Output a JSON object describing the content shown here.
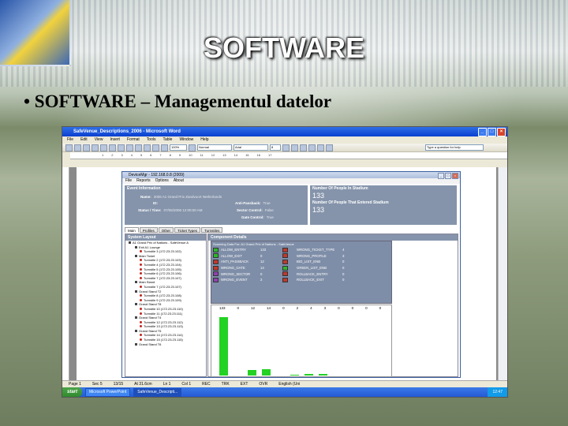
{
  "slide": {
    "title": "SOFTWARE",
    "bullet": "• SOFTWARE – Managementul datelor"
  },
  "word": {
    "window_title": "SafeVenue_Descriptions_2006 - Microsoft Word",
    "menus": [
      "File",
      "Edit",
      "View",
      "Insert",
      "Format",
      "Tools",
      "Table",
      "Window",
      "Help"
    ],
    "zoom": "100%",
    "style": "Normal",
    "font": "Arial",
    "size": "8",
    "help_placeholder": "Type a question for help",
    "ruler_ticks": [
      "1",
      "2",
      "3",
      "4",
      "5",
      "6",
      "7",
      "8",
      "9",
      "10",
      "11",
      "12",
      "13",
      "14",
      "15",
      "16",
      "17"
    ],
    "status": [
      "Page 1",
      "Sec 5",
      "13/15",
      "At 31.6cm",
      "Ln 1",
      "Col 1",
      "REC",
      "TRK",
      "EXT",
      "OVR",
      "English (Uni"
    ]
  },
  "taskbar": {
    "start": "start",
    "tasks": [
      "Microsoft PowerPoint",
      "SafeVenue_Descripti..."
    ],
    "clock": "12:47"
  },
  "app": {
    "title": "DeviceMgr - 192.168.0.8 (2009)",
    "menu": [
      "File",
      "Reports",
      "Options",
      "About"
    ],
    "event_header": "Event Information",
    "event_name_label": "Name:",
    "event_name": "2006 A1 Grand Prix Zandvoort Netherlands",
    "id_label": "ID:",
    "id_value": "",
    "status_label": "Status / Time:",
    "status_value": "07/06/2006 12:00:00 AM",
    "anti_label": "Anti-Passback:",
    "anti_value": "True",
    "sector_label": "Sector Control:",
    "sector_value": "False",
    "gate_label": "Gate Control:",
    "gate_value": "True",
    "np_header": "Number Of People In Stadium",
    "np_value": "133",
    "np2_header": "Number Of People That Entered Stadium",
    "np2_value": "133",
    "tabs": [
      "Main",
      "Profiles",
      "Other",
      "Ticket Types",
      "Turnstiles"
    ],
    "system_layout": "System Layout",
    "tree": [
      {
        "level": 1,
        "kind": "sq",
        "text": "A1 Grand Prix of Nations - SafeVenue A"
      },
      {
        "level": 2,
        "kind": "sq",
        "text": "Exit A1 Lounge"
      },
      {
        "level": 3,
        "kind": "dot",
        "text": "Turnstile 3 (172.23.23.102)"
      },
      {
        "level": 2,
        "kind": "sq",
        "text": "Main Ticket"
      },
      {
        "level": 3,
        "kind": "dot",
        "text": "Turnstile 2 (172.23.23.103)"
      },
      {
        "level": 3,
        "kind": "dot",
        "text": "Turnstile 4 (172.23.23.104)"
      },
      {
        "level": 3,
        "kind": "dot",
        "text": "Turnstile 5 (172.23.23.105)"
      },
      {
        "level": 3,
        "kind": "dot",
        "text": "Turnstile 6 (172.23.23.106)"
      },
      {
        "level": 3,
        "kind": "dot",
        "text": "Turnstile 7 (172.23.23.107)"
      },
      {
        "level": 2,
        "kind": "sq",
        "text": "Main Stand"
      },
      {
        "level": 3,
        "kind": "dot",
        "text": "Turnstile 7 (172.23.23.107)"
      },
      {
        "level": 2,
        "kind": "sq",
        "text": "Grand Stand T2"
      },
      {
        "level": 3,
        "kind": "dot",
        "text": "Turnstile 8 (172.23.23.108)"
      },
      {
        "level": 3,
        "kind": "dot",
        "text": "Turnstile 9 (172.23.23.109)"
      },
      {
        "level": 2,
        "kind": "sq",
        "text": "Grand Stand T8"
      },
      {
        "level": 3,
        "kind": "dot",
        "text": "Turnstile 10 (172.23.23.110)"
      },
      {
        "level": 3,
        "kind": "dot",
        "text": "Turnstile 11 (172.23.23.111)"
      },
      {
        "level": 2,
        "kind": "sq",
        "text": "Grand Stand T4"
      },
      {
        "level": 3,
        "kind": "dot",
        "text": "Turnstile 12 (172.23.23.112)"
      },
      {
        "level": 3,
        "kind": "dot",
        "text": "Turnstile 13 (172.23.23.113)"
      },
      {
        "level": 2,
        "kind": "sq",
        "text": "Grand Stand T5"
      },
      {
        "level": 3,
        "kind": "dot",
        "text": "Turnstile 14 (172.23.23.114)"
      },
      {
        "level": 3,
        "kind": "dot",
        "text": "Turnstile 15 (172.23.23.115)"
      },
      {
        "level": 2,
        "kind": "sq",
        "text": "Grand Stand T6"
      }
    ],
    "component_details": "Component Details",
    "grid_header": "Scanning Data For: A1 Grand Prix of Nations - SafeVenue",
    "grid": [
      {
        "c1": "#2fb52f",
        "n1": "ALLOW_ENTRY",
        "v1": "133",
        "c2": "#c0392b",
        "n2": "WRONG_TICKET_TYPE",
        "v2": "4"
      },
      {
        "c1": "#2fb52f",
        "n1": "ALLOW_EXIT",
        "v1": "0",
        "c2": "#c0392b",
        "n2": "WRONG_PROFILE",
        "v2": "3"
      },
      {
        "c1": "#c0392b",
        "n1": "ANTI_PASSBACK",
        "v1": "12",
        "c2": "#c0392b",
        "n2": "BIO_LIST_ENB",
        "v2": "0"
      },
      {
        "c1": "#c0392b",
        "n1": "WRONG_GATE",
        "v1": "14",
        "c2": "#2fb52f",
        "n2": "GREEN_LIST_ENB",
        "v2": "0"
      },
      {
        "c1": "#8e44ad",
        "n1": "WRONG_SECTOR",
        "v1": "0",
        "c2": "#c0392b",
        "n2": "ROLLBACK_ENTRY",
        "v2": "0"
      },
      {
        "c1": "#8e44ad",
        "n1": "WRONG_EVENT",
        "v1": "2",
        "c2": "#c0392b",
        "n2": "ROLLBACK_EXIT",
        "v2": "0"
      }
    ],
    "chart_labels": [
      "133",
      "0",
      "12",
      "14",
      "0",
      "2",
      "4",
      "3",
      "0",
      "0",
      "0",
      "0"
    ]
  },
  "chart_data": {
    "type": "bar",
    "categories": [
      "ALLOW_ENTRY",
      "ALLOW_EXIT",
      "ANTI_PASSBACK",
      "WRONG_GATE",
      "WRONG_SECTOR",
      "WRONG_EVENT",
      "WRONG_TICKET_TYPE",
      "WRONG_PROFILE",
      "BIO_LIST_ENB",
      "GREEN_LIST_ENB",
      "ROLLBACK_ENTRY",
      "ROLLBACK_EXIT"
    ],
    "values": [
      133,
      0,
      12,
      14,
      0,
      2,
      4,
      3,
      0,
      0,
      0,
      0
    ],
    "ylim": [
      0,
      140
    ]
  }
}
